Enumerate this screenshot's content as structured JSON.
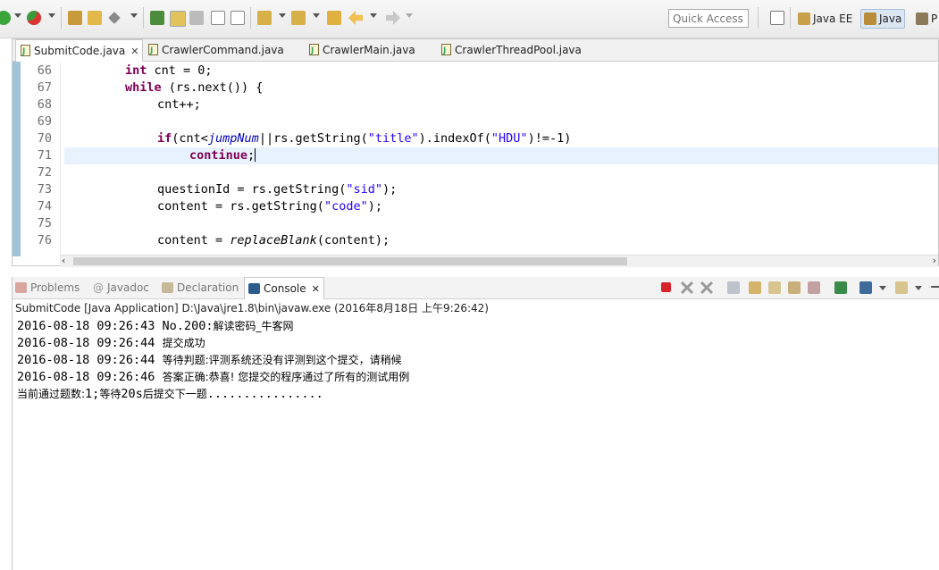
{
  "toolbar": {
    "quick_access_placeholder": "Quick Access",
    "perspectives": [
      {
        "label": "Java EE",
        "active": false
      },
      {
        "label": "Java",
        "active": true
      },
      {
        "label": "P",
        "active": false
      }
    ]
  },
  "editor": {
    "tabs": [
      {
        "label": "SubmitCode.java",
        "active": true,
        "close": "✕"
      },
      {
        "label": "CrawlerCommand.java",
        "active": false
      },
      {
        "label": "CrawlerMain.java",
        "active": false
      },
      {
        "label": "CrawlerThreadPool.java",
        "active": false
      }
    ],
    "line_numbers": [
      "66",
      "67",
      "68",
      "69",
      "70",
      "71",
      "72",
      "73",
      "74",
      "75",
      "76"
    ],
    "code": {
      "l66_kw": "int",
      "l66_rest": " cnt = 0;",
      "l67_kw": "while",
      "l67_rest": " (rs.next()) {",
      "l68": "cnt++;",
      "l70_kw": "if",
      "l70_a": "(cnt<",
      "l70_field": "jumpNum",
      "l70_b": "||rs.getString(",
      "l70_s1": "\"title\"",
      "l70_c": ").indexOf(",
      "l70_s2": "\"HDU\"",
      "l70_d": ")!=-1)",
      "l71_kw": "continue",
      "l71_rest": ";",
      "l73_a": "questionId = rs.getString(",
      "l73_s": "\"sid\"",
      "l73_b": ");",
      "l74_a": "content = rs.getString(",
      "l74_s": "\"code\"",
      "l74_b": ");",
      "l76_a": "content = ",
      "l76_it": "replaceBlank",
      "l76_b": "(content);"
    }
  },
  "console": {
    "tabs": [
      {
        "label": "Problems",
        "active": false
      },
      {
        "label": "Javadoc",
        "active": false
      },
      {
        "label": "Declaration",
        "active": false
      },
      {
        "label": "Console",
        "active": true,
        "close": "✕"
      }
    ],
    "description": "SubmitCode [Java Application] D:\\Java\\jre1.8\\bin\\javaw.exe (2016年8月18日 上午9:26:42)",
    "lines": [
      {
        "ts": "2016-08-18 09:26:43 No.200:",
        "msg": "解读密码_牛客网"
      },
      {
        "ts": "2016-08-18 09:26:44 ",
        "msg": "提交成功"
      },
      {
        "ts": "2016-08-18 09:26:44 ",
        "msg": "等待判题:评测系统还没有评测到这个提交，请稍候"
      },
      {
        "ts": "2016-08-18 09:26:46 ",
        "msg": "答案正确:恭喜! 您提交的程序通过了所有的测试用例"
      }
    ],
    "summary_a": "当前通过题数:",
    "summary_b": "1;",
    "summary_c": "等待",
    "summary_d": "20s",
    "summary_e": "后提交下一题",
    "summary_f": "................"
  },
  "colors": {
    "keyword": "#7f0055",
    "string": "#2a00ff",
    "field": "#0000c0",
    "current_line": "#e8f2fe",
    "stop_button": "#d9232b"
  }
}
